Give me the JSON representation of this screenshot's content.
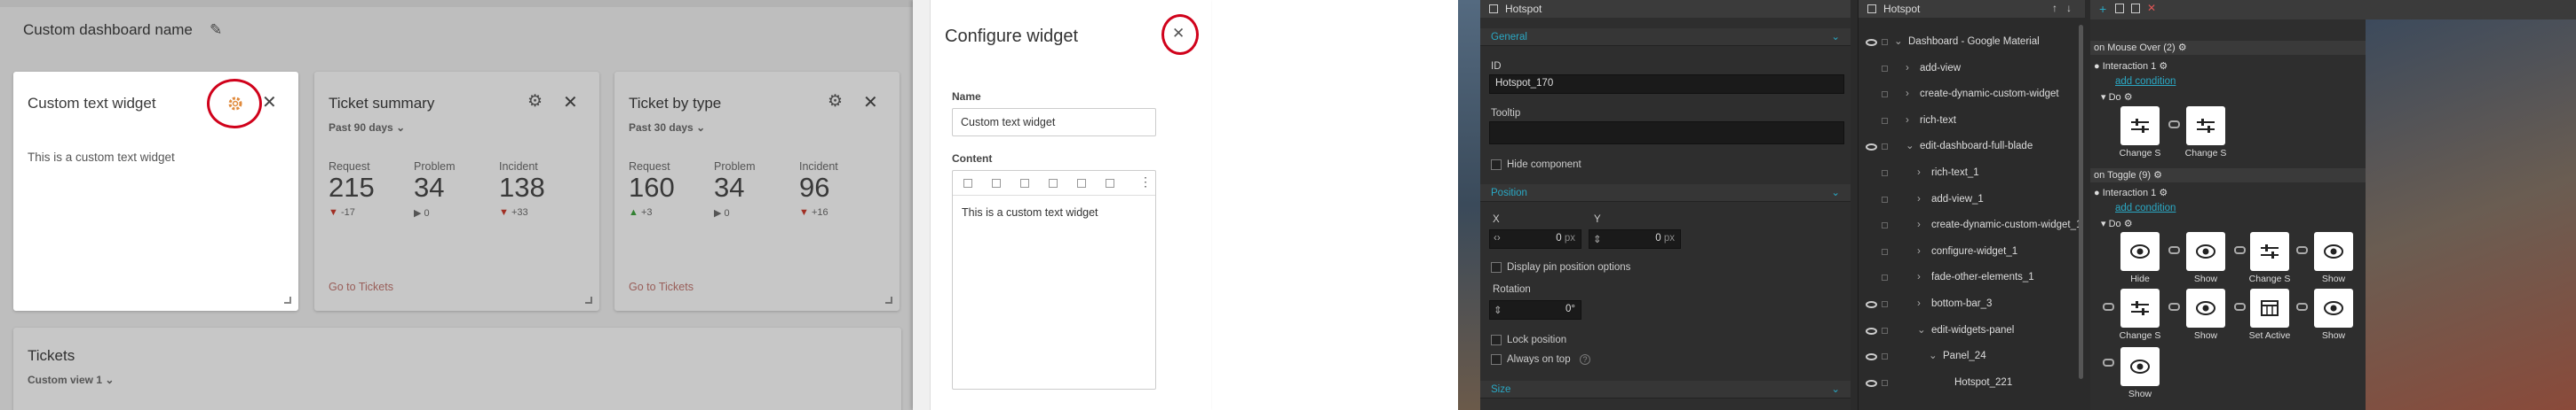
{
  "dashboard": {
    "title": "Custom dashboard name",
    "active_card": {
      "title": "Custom text widget",
      "body": "This is a custom text widget"
    },
    "ticket_summary": {
      "title": "Ticket summary",
      "period": "Past 90 days",
      "link": "Go to Tickets",
      "metrics": [
        {
          "label": "Request",
          "value": "215",
          "delta": "-17",
          "dir": "down"
        },
        {
          "label": "Problem",
          "value": "34",
          "delta": "0",
          "dir": "flat"
        },
        {
          "label": "Incident",
          "value": "138",
          "delta": "+33",
          "dir": "down"
        }
      ]
    },
    "ticket_type": {
      "title": "Ticket by type",
      "period": "Past 30 days",
      "link": "Go to Tickets",
      "metrics": [
        {
          "label": "Request",
          "value": "160",
          "delta": "+3",
          "dir": "up"
        },
        {
          "label": "Problem",
          "value": "34",
          "delta": "0",
          "dir": "flat"
        },
        {
          "label": "Incident",
          "value": "96",
          "delta": "+16",
          "dir": "down"
        }
      ]
    },
    "tickets": {
      "title": "Tickets",
      "view": "Custom view 1"
    }
  },
  "config": {
    "title": "Configure widget",
    "name_label": "Name",
    "name_value": "Custom text widget",
    "content_label": "Content",
    "content_value": "This is a custom text widget"
  },
  "props": {
    "title": "Hotspot",
    "general": "General",
    "id_label": "ID",
    "id_value": "Hotspot_170",
    "tooltip_label": "Tooltip",
    "hide_label": "Hide component",
    "position": "Position",
    "x_label": "X",
    "y_label": "Y",
    "x_value": "0",
    "y_value": "0",
    "unit": "px",
    "display_pin": "Display pin position options",
    "rotation_label": "Rotation",
    "rotation_value": "0°",
    "lock": "Lock position",
    "always_top": "Always on top",
    "size": "Size"
  },
  "tree": {
    "title": "Hotspot",
    "items": [
      {
        "label": "Dashboard - Google Material",
        "indent": 0,
        "eye": true,
        "arrow": "down"
      },
      {
        "label": "add-view",
        "indent": 1,
        "eye": false,
        "arrow": "right"
      },
      {
        "label": "create-dynamic-custom-widget",
        "indent": 1,
        "eye": false,
        "arrow": "right"
      },
      {
        "label": "rich-text",
        "indent": 1,
        "eye": false,
        "arrow": "right"
      },
      {
        "label": "edit-dashboard-full-blade",
        "indent": 1,
        "eye": true,
        "arrow": "down"
      },
      {
        "label": "rich-text_1",
        "indent": 2,
        "eye": false,
        "arrow": "right"
      },
      {
        "label": "add-view_1",
        "indent": 2,
        "eye": false,
        "arrow": "right"
      },
      {
        "label": "create-dynamic-custom-widget_1",
        "indent": 2,
        "eye": false,
        "arrow": "right"
      },
      {
        "label": "configure-widget_1",
        "indent": 2,
        "eye": false,
        "arrow": "right"
      },
      {
        "label": "fade-other-elements_1",
        "indent": 2,
        "eye": false,
        "arrow": "right"
      },
      {
        "label": "bottom-bar_3",
        "indent": 2,
        "eye": true,
        "arrow": "right"
      },
      {
        "label": "edit-widgets-panel",
        "indent": 2,
        "eye": true,
        "arrow": "down"
      },
      {
        "label": "Panel_24",
        "indent": 3,
        "eye": true,
        "arrow": "down"
      },
      {
        "label": "Hotspot_221",
        "indent": 4,
        "eye": true,
        "arrow": "none"
      }
    ]
  },
  "events": {
    "mouse_over": "on Mouse Over (2)",
    "toggle": "on Toggle (9)",
    "interaction": "Interaction 1",
    "add_condition": "add condition",
    "do": "Do",
    "labels": {
      "change": "Change S",
      "hide": "Hide",
      "show": "Show",
      "set_active": "Set Active"
    }
  },
  "colors": {
    "accent": "#2aa8c4",
    "annotation": "#d0021b",
    "panel": "#2b2b2b"
  }
}
